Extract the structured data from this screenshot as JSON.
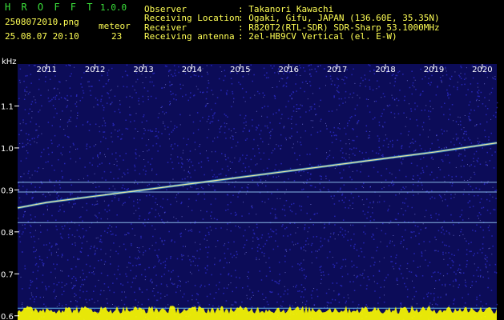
{
  "header": {
    "app_name": "H R O F F T",
    "version": "1.0.0",
    "filename": "2508072010.png",
    "datetime": "25.08.07 20:10",
    "meteor_label": "meteor",
    "meteor_count": "23",
    "info": [
      {
        "label": "Observer",
        "value": ": Takanori Kawachi"
      },
      {
        "label": "Receiving Location",
        "value": ": Ogaki, Gifu, JAPAN (136.60E, 35.35N)"
      },
      {
        "label": "Receiver",
        "value": ": R820T2(RTL-SDR) SDR-Sharp 53.1000MHz"
      },
      {
        "label": "Receiving antenna",
        "value": ": 2el-HB9CV Vertical (el. E-W)"
      }
    ]
  },
  "colors": {
    "text_green": "#3be23b",
    "text_yellow": "#ffff55",
    "background": "#000000",
    "noise_base": "#14147a",
    "trace": "#e6e6a0",
    "bottom_band": "#ffff00"
  },
  "chart_data": {
    "type": "spectrogram",
    "ylabel": "kHz",
    "ylim": [
      0.59,
      1.2
    ],
    "xlim": [
      2010.4,
      2020.3
    ],
    "x_ticks": [
      "2011",
      "2012",
      "2013",
      "2014",
      "2015",
      "2016",
      "2017",
      "2018",
      "2019",
      "2020"
    ],
    "x_tick_values": [
      2011,
      2012,
      2013,
      2014,
      2015,
      2016,
      2017,
      2018,
      2019,
      2020
    ],
    "y_ticks": [
      "1.1",
      "1.0",
      "0.9",
      "0.8",
      "0.7",
      "0.6"
    ],
    "y_tick_values": [
      1.1,
      1.0,
      0.9,
      0.8,
      0.7,
      0.6
    ],
    "series": [
      {
        "x": [
          2010.4,
          2011.0,
          2012.0,
          2013.0,
          2014.0,
          2015.0,
          2016.0,
          2017.0,
          2018.0,
          2019.0,
          2020.3
        ],
        "y": [
          0.857,
          0.87,
          0.885,
          0.9,
          0.915,
          0.93,
          0.945,
          0.96,
          0.975,
          0.99,
          1.012
        ]
      }
    ],
    "horizontal_lines_khz": [
      0.918,
      0.895,
      0.822,
      0.618
    ]
  }
}
